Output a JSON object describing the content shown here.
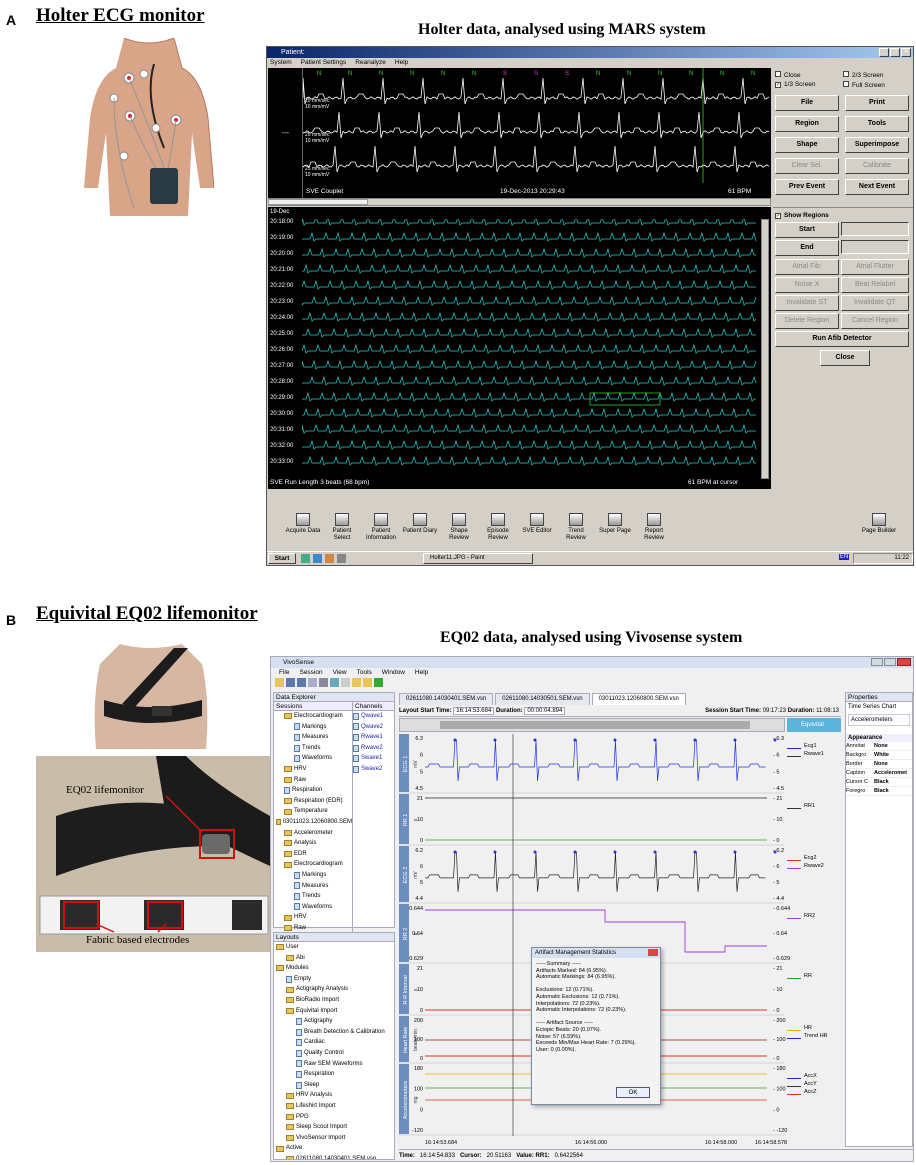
{
  "panel_a": {
    "label": "A",
    "title": "Holter ECG monitor",
    "subtitle": "Holter data, analysed using MARS system"
  },
  "mars": {
    "window_title": "Patient:",
    "menu": [
      "System",
      "Patient Settings",
      "Reanalyze",
      "Help"
    ],
    "dash": "---",
    "top_labels": [
      "25 mm/sec",
      "10 mm/mV",
      "25 mm/sec",
      "10 mm/mV",
      "25 mm/sec",
      "10 mm/mV"
    ],
    "event_label": "SVE Couplet",
    "timestamp": "19-Dec-2013 20:29:43",
    "bpm": "61 BPM",
    "date_label": "19-Dec",
    "times": [
      "20:18:00",
      "20:19:00",
      "20:20:00",
      "20:21:00",
      "20:22:00",
      "20:23:00",
      "20:24:00",
      "20:25:00",
      "20:26:00",
      "20:27:00",
      "20:28:00",
      "20:29:00",
      "20:30:00",
      "20:31:00",
      "20:32:00",
      "20:33:00"
    ],
    "bottom_status": "SVE Run Length 3 beats (68 bpm)",
    "bottom_bpm": "61 BPM at cursor",
    "checks": [
      "Close",
      "2/3 Screen",
      "1/3 Screen",
      "Full Screen"
    ],
    "buttons_top": [
      [
        "File",
        "Print"
      ],
      [
        "Region",
        "Tools"
      ],
      [
        "Shape",
        "Superimpose"
      ],
      [
        "Clear Sel.",
        "Calibrate"
      ],
      [
        "Prev Event",
        "Next Event"
      ]
    ],
    "show_regions": "Show Regions",
    "start": "Start",
    "end": "End",
    "region_buttons": [
      [
        "Atrial Fib.",
        "Atrial Flutter"
      ],
      [
        "Noise X",
        "Beat Relabel"
      ],
      [
        "Invalidate ST",
        "Invalidate QT"
      ],
      [
        "Delete Region",
        "Cancel Region"
      ]
    ],
    "run_afib": "Run Afib Detector",
    "close": "Close",
    "toolbar": [
      "Acquire Data",
      "Patient Select",
      "Patient Information",
      "Patient Diary",
      "Shape Review",
      "Episode Review",
      "SVE Editor",
      "Trend Review",
      "Super Page",
      "Report Review",
      "Page Builder"
    ],
    "taskbar": {
      "start": "Start",
      "task": "Holter11.JPG - Paint",
      "lang": "EN",
      "clock": "11:22"
    },
    "beat_letters": [
      "N",
      "N",
      "N",
      "N",
      "N",
      "N",
      "S",
      "S",
      "S",
      "N",
      "N",
      "N",
      "N",
      "N",
      "N"
    ]
  },
  "panel_b": {
    "label": "B",
    "title": "Equivital EQ02 lifemonitor",
    "subtitle": "EQ02 data, analysed using Vivosense system",
    "device_label": "EQ02 lifemonitor",
    "electrode_label": "Fabric based electrodes"
  },
  "vivo": {
    "title": "VivoSense",
    "menu": [
      "File",
      "Session",
      "View",
      "Tools",
      "Window",
      "Help"
    ],
    "data_explorer": "Data Explorer",
    "sessions": "Sessions",
    "channels": "Channels",
    "session_tree": [
      "Electrocardiogram",
      "Markings",
      "Measures",
      "Trends",
      "Waveforms",
      "HRV",
      "Raw",
      "Respiration",
      "Respiration (EDR)",
      "Temperature",
      "03011023.12060800.SEM",
      "Accelerometer",
      "Analysis",
      "EDR",
      "Electrocardiogram",
      "Markings",
      "Measures",
      "Trends",
      "Waveforms",
      "HRV",
      "Raw"
    ],
    "channel_list": [
      "Qwave1",
      "Qwave2",
      "Rwave1",
      "Rwave2",
      "Swave1",
      "Swave2"
    ],
    "layouts": "Layouts",
    "layout_tree": [
      "User",
      "Abi",
      "Modules",
      "Empty",
      "Actigraphy Analysis",
      "BioRadio Import",
      "Equivital Import",
      "Actigraphy",
      "Breath Detection & Calibration",
      "Cardiac",
      "Quality Control",
      "Raw SEM Waveforms",
      "Respiration",
      "Sleep",
      "HRV Analysis",
      "Lifeshirt Import",
      "PPG",
      "Sleep Scout Import",
      "VivoSensor Import",
      "Active",
      "02611080.14030401.SEM.vsn"
    ],
    "tabs": [
      "02611080.14030401.SEM.vsn",
      "02611080.14030501.SEM.vsn",
      "03011023.12060800.SEM.vsn"
    ],
    "layout_start_label": "Layout Start Time:",
    "layout_start": "16:14:53.684",
    "duration_label": "Duration:",
    "duration": "00:00:04.894",
    "session_start_label": "Session Start Time:",
    "session_start": "09:17:23",
    "session_duration_label": "Duration:",
    "session_duration": "11:08:13",
    "equivital_tab": "Equivital",
    "strips": [
      {
        "side": "ECG 1",
        "unit": "mV",
        "ticks": [
          "6.3",
          "6",
          "5",
          "4.5"
        ],
        "rticks": [
          "6.3",
          "6",
          "5",
          "4.5"
        ],
        "legend": [
          "Ecg1",
          "Rwave1"
        ]
      },
      {
        "side": "RR 1",
        "unit": "s",
        "ticks": [
          "21",
          "10",
          "0"
        ],
        "rticks": [
          "21",
          "10",
          "0"
        ],
        "legend": [
          "RR1"
        ]
      },
      {
        "side": "ECG 2",
        "unit": "mV",
        "ticks": [
          "6.2",
          "6",
          "5",
          "4.4"
        ],
        "rticks": [
          "6.2",
          "6",
          "5",
          "4.4"
        ],
        "legend": [
          "Ecg2",
          "Rwave2"
        ]
      },
      {
        "side": "RR 2",
        "unit": "s",
        "ticks": [
          "0.644",
          "0.64",
          "0.629"
        ],
        "rticks": [
          "0.644",
          "0.64",
          "0.629"
        ],
        "legend": [
          "RR2"
        ]
      },
      {
        "side": "R-R Interval",
        "unit": "s",
        "ticks": [
          "21",
          "10",
          "0"
        ],
        "rticks": [
          "21",
          "10",
          "0"
        ],
        "legend": [
          "RR"
        ]
      },
      {
        "side": "Heart Rate",
        "unit": "beats/min",
        "ticks": [
          "200",
          "100",
          "0"
        ],
        "rticks": [
          "200",
          "100",
          "0"
        ],
        "legend": [
          "HR",
          "Trend HR"
        ]
      },
      {
        "side": "Accelerometers",
        "unit": "mg",
        "ticks": [
          "180",
          "100",
          "0",
          "-120"
        ],
        "rticks": [
          "180",
          "100",
          "0",
          "-120"
        ],
        "legend": [
          "AccX",
          "AccY",
          "AccZ"
        ]
      }
    ],
    "x_ticks": [
      "16:14:53.684",
      "16:14:56.000",
      "16:14:58.000",
      "16:14:58.578"
    ],
    "status": {
      "time_label": "Time:",
      "time": "16:14:54.833",
      "cursor_label": "Cursor:",
      "cursor": "20.51163",
      "value_label": "Value: RR1:",
      "value": "0.6422564"
    },
    "properties": {
      "title": "Properties",
      "subtitle": "Time Series Chart",
      "section": "Accelerometers",
      "group": "Appearance",
      "rows": [
        [
          "Annotat",
          "None"
        ],
        [
          "Backgro",
          "White"
        ],
        [
          "Border",
          "None"
        ],
        [
          "Caption",
          "Acceleromet"
        ],
        [
          "Cursor C",
          "Black"
        ],
        [
          "Foregro",
          "Black"
        ]
      ]
    },
    "dialog": {
      "title": "Artifact Management Statistics",
      "lines": [
        "----- Summary -----",
        "Artifacts Marked: 84 (6.95%).",
        "Automatic Markings: 84 (6.95%).",
        "",
        "Exclusions: 12 (0.71%).",
        "Automatic Exclusions: 12 (0.71%).",
        "Interpolations: 72 (0.23%).",
        "Automatic Interpolations: 72 (0.23%).",
        "",
        "----- Artifact Source -----",
        "Ectopic Beats: 20 (0.07%).",
        "Noise: 57 (6.59%).",
        "Exceeds Min/Max Heart Rate: 7 (0.29%).",
        "User: 0 (0.00%)."
      ],
      "ok": "OK"
    }
  },
  "colors": {
    "mars_trace": "#ffffff",
    "mars_cyan": "#27d0c8",
    "mars_bg": "#000000",
    "vivo_blue": "#2233dd",
    "vivo_purple": "#a040e0",
    "vivo_green": "#2aa02a",
    "vivo_red": "#e03020"
  }
}
